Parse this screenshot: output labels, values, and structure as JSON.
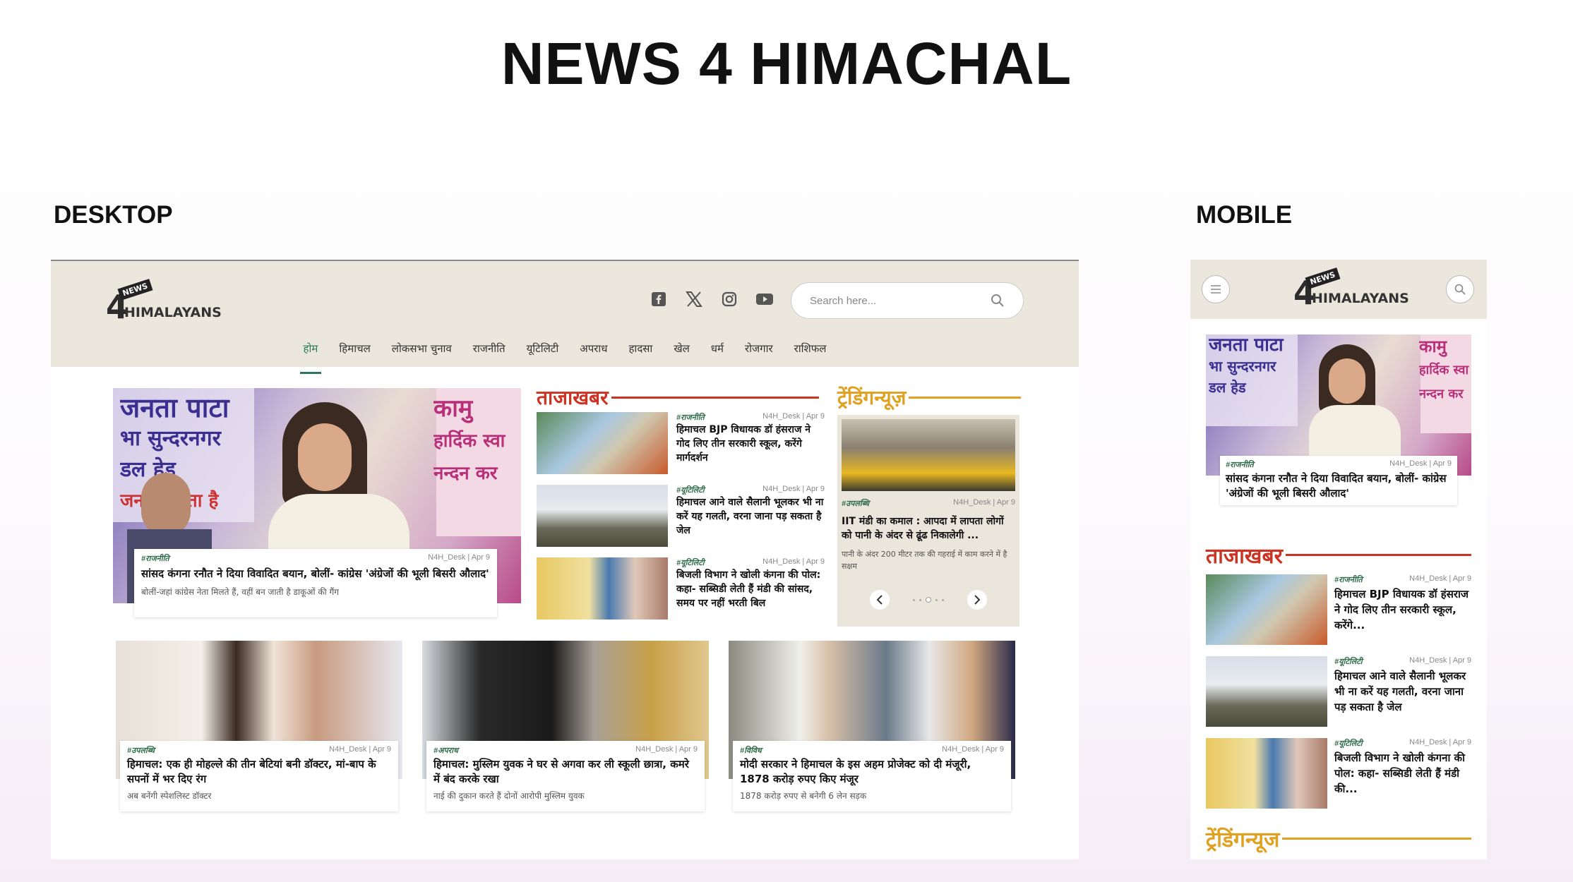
{
  "page_title": "NEWS 4 HIMACHAL",
  "labels": {
    "desktop": "DESKTOP",
    "mobile": "MOBILE"
  },
  "logo": {
    "four": "4",
    "himalayans": "HIMALAYANS",
    "news": "NEWS"
  },
  "search": {
    "placeholder": "Search here..."
  },
  "social_icons": [
    "facebook-icon",
    "x-icon",
    "instagram-icon",
    "youtube-icon"
  ],
  "nav": [
    "होम",
    "हिमाचल",
    "लोकसभा चुनाव",
    "राजनीति",
    "यूटिलिटी",
    "अपराध",
    "हादसा",
    "खेल",
    "धर्म",
    "रोजगार",
    "राशिफल"
  ],
  "colors": {
    "accent": "#2a7a5a",
    "tajakhabar": "#cc3322",
    "trending": "#e0a020",
    "header_bg": "#ebe7dd"
  },
  "hero": {
    "tag": "#राजनीति",
    "meta": "N4H_Desk | Apr 9",
    "headline": "सांसद कंगना रनौत ने दिया विवादित बयान, बोलीं- कांग्रेस 'अंग्रेजों की भूली बिसरी औलाद'",
    "sub": "बोलीं-जहां कांग्रेस नेता मिलते हैं, वहीं बन जाती है डाकूओं की गैंग",
    "poster_left": [
      "जनता पाटा",
      "भा सुन्दरनगर",
      "डल हेड",
      "जनता करता है"
    ],
    "poster_right": [
      "कामु",
      "हार्दिक स्वा",
      "नन्दन कर"
    ]
  },
  "tajakhabar": {
    "title": "ताजाखबर",
    "items": [
      {
        "tag": "#राजनीति",
        "meta": "N4H_Desk | Apr 9",
        "headline": "हिमाचल BJP विधायक डॉ हंसराज ने गोद लिए तीन सरकारी स्कूल, करेंगे मार्गदर्शन"
      },
      {
        "tag": "#यूटिलिटी",
        "meta": "N4H_Desk | Apr 9",
        "headline": "हिमाचल आने वाले सैलानी भूलकर भी ना करें यह गलती, वरना जाना पड़ सकता है जेल"
      },
      {
        "tag": "#यूटिलिटी",
        "meta": "N4H_Desk | Apr 9",
        "headline": "बिजली विभाग ने खोली कंगना की पोल: कहा- सब्सिडी लेती हैं मंडी की सांसद, समय पर नहीं भरती बिल"
      }
    ]
  },
  "trending": {
    "title": "ट्रेंडिंगन्यूज़",
    "tag": "#उपलब्धि",
    "meta": "N4H_Desk | Apr 9",
    "headline": "IIT मंडी का कमाल : आपदा में लापता लोगों को पानी के अंदर से ढूंढ निकालेगी ...",
    "sub": "पानी के अंदर 200 मीटर तक की गहराई में काम करने में है सक्षम"
  },
  "bottom": [
    {
      "tag": "#उपलब्धि",
      "meta": "N4H_Desk | Apr 9",
      "headline": "हिमाचल: एक ही मोहल्ले की तीन बेटियां बनी डॉक्टर, मां-बाप के सपनों में भर दिए रंग",
      "sub": "अब बनेंगी स्पेशलिस्ट डॉक्टर"
    },
    {
      "tag": "#अपराध",
      "meta": "N4H_Desk | Apr 9",
      "headline": "हिमाचल: मुस्लिम युवक ने घर से अगवा कर ली स्कूली छात्रा, कमरे में बंद करके रखा",
      "sub": "नाई की दुकान करते हैं दोनों आरोपी मुस्लिम युवक"
    },
    {
      "tag": "#विविध",
      "meta": "N4H_Desk | Apr 9",
      "headline": "मोदी सरकार ने हिमाचल के इस अहम प्रोजेक्ट को दी मंजूरी, 1878 करोड़ रुपए किए मंजूर",
      "sub": "1878 करोड़ रुपए से बनेगी 6 लेन सड़क"
    }
  ],
  "mobile": {
    "hero_tag": "#राजनीति",
    "hero_meta": "N4H_Desk | Apr 9",
    "hero_headline": "सांसद कंगना रनौत ने दिया विवादित बयान, बोलीं- कांग्रेस 'अंग्रेजों की भूली बिसरी औलाद'",
    "tajakhabar_title": "ताजाखबर",
    "items": [
      {
        "tag": "#राजनीति",
        "meta": "N4H_Desk | Apr 9",
        "headline": "हिमाचल BJP विधायक डॉ हंसराज ने गोद लिए तीन सरकारी स्कूल, करेंगे..."
      },
      {
        "tag": "#यूटिलिटी",
        "meta": "N4H_Desk | Apr 9",
        "headline": "हिमाचल आने वाले सैलानी भूलकर भी ना करें यह गलती, वरना जाना पड़ सकता है जेल"
      },
      {
        "tag": "#यूटिलिटी",
        "meta": "N4H_Desk | Apr 9",
        "headline": "बिजली विभाग ने खोली कंगना की पोल: कहा- सब्सिडी लेती हैं मंडी की..."
      }
    ],
    "trending_title": "ट्रेंडिंगन्यूज"
  }
}
